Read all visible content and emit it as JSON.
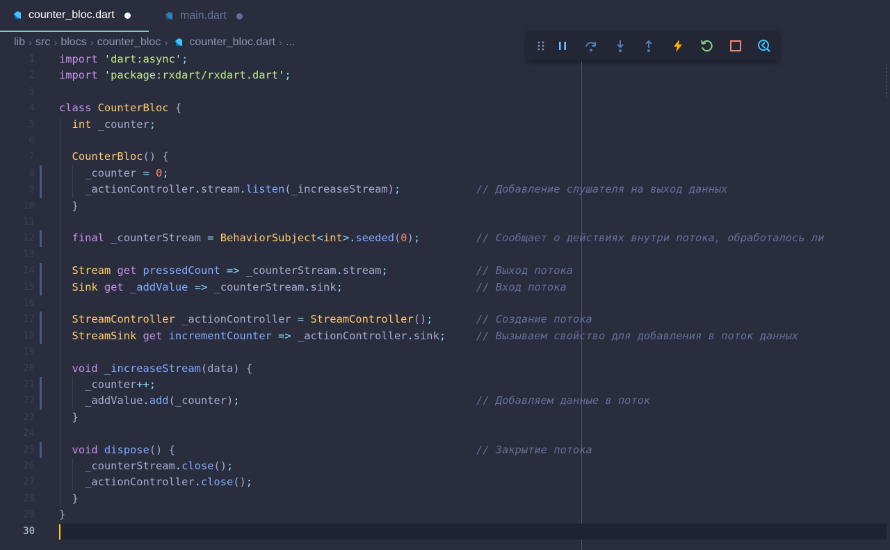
{
  "tabs": [
    {
      "label": "counter_bloc.dart",
      "active": true,
      "dirty": true
    },
    {
      "label": "main.dart",
      "active": false,
      "dirty": true
    }
  ],
  "breadcrumb": [
    "lib",
    "src",
    "blocs",
    "counter_bloc",
    "counter_bloc.dart",
    "..."
  ],
  "debug_toolbar": [
    "grip-icon",
    "pause-icon",
    "step-over-icon",
    "step-into-icon",
    "step-out-icon",
    "hot-reload-icon",
    "hot-restart-icon",
    "stop-icon",
    "devtools-icon"
  ],
  "colors": {
    "background": "#292d3e",
    "keyword": "#c792ea",
    "string": "#c3e88d",
    "class": "#ffcb6b",
    "function": "#82aaff",
    "number": "#f78c6c",
    "operator": "#89ddff",
    "comment": "#676e95",
    "cursor": "#ffcc00"
  },
  "current_line": 30,
  "lines": [
    {
      "n": "1",
      "tokens": [
        [
          "import ",
          "k"
        ],
        [
          "'dart:async'",
          "s"
        ],
        [
          ";",
          "o"
        ]
      ],
      "comment": ""
    },
    {
      "n": "2",
      "tokens": [
        [
          "import ",
          "k"
        ],
        [
          "'package:rxdart/rxdart.dart'",
          "s"
        ],
        [
          ";",
          "o"
        ]
      ],
      "comment": ""
    },
    {
      "n": "3",
      "tokens": [],
      "comment": ""
    },
    {
      "n": "4",
      "tokens": [
        [
          "class ",
          "k"
        ],
        [
          "CounterBloc",
          "c"
        ],
        [
          " {",
          "p"
        ]
      ],
      "comment": ""
    },
    {
      "n": "5",
      "tokens": [
        [
          "  ",
          "p"
        ],
        [
          "int",
          "c"
        ],
        [
          " _counter",
          "p"
        ],
        [
          ";",
          "o"
        ]
      ],
      "comment": ""
    },
    {
      "n": "6",
      "tokens": [],
      "comment": ""
    },
    {
      "n": "7",
      "tokens": [
        [
          "  ",
          "p"
        ],
        [
          "CounterBloc",
          "c"
        ],
        [
          "() {",
          "p"
        ]
      ],
      "comment": ""
    },
    {
      "n": "8",
      "tokens": [
        [
          "    _counter ",
          "p"
        ],
        [
          "=",
          "o"
        ],
        [
          " ",
          "p"
        ],
        [
          "0",
          "n"
        ],
        [
          ";",
          "o"
        ]
      ],
      "comment": ""
    },
    {
      "n": "9",
      "tokens": [
        [
          "    _actionController",
          "p"
        ],
        [
          ".",
          "o"
        ],
        [
          "stream",
          "p"
        ],
        [
          ".",
          "o"
        ],
        [
          "listen",
          "f"
        ],
        [
          "(_increaseStream)",
          "p"
        ],
        [
          ";",
          "o"
        ]
      ],
      "comment": "// Добавление слушателя на выход данных"
    },
    {
      "n": "10",
      "tokens": [
        [
          "  }",
          "p"
        ]
      ],
      "comment": ""
    },
    {
      "n": "11",
      "tokens": [],
      "comment": ""
    },
    {
      "n": "12",
      "tokens": [
        [
          "  ",
          "p"
        ],
        [
          "final",
          "k"
        ],
        [
          " _counterStream ",
          "p"
        ],
        [
          "=",
          "o"
        ],
        [
          " ",
          "p"
        ],
        [
          "BehaviorSubject",
          "c"
        ],
        [
          "<",
          "o"
        ],
        [
          "int",
          "c"
        ],
        [
          ">",
          "o"
        ],
        [
          ".",
          "o"
        ],
        [
          "seeded",
          "f"
        ],
        [
          "(",
          "p"
        ],
        [
          "0",
          "n"
        ],
        [
          ")",
          "p"
        ],
        [
          ";",
          "o"
        ]
      ],
      "comment": "// Сообщает о действиях внутри потока, обработалось ли"
    },
    {
      "n": "13",
      "tokens": [],
      "comment": ""
    },
    {
      "n": "14",
      "tokens": [
        [
          "  ",
          "p"
        ],
        [
          "Stream",
          "c"
        ],
        [
          " ",
          "p"
        ],
        [
          "get",
          "k"
        ],
        [
          " ",
          "p"
        ],
        [
          "pressedCount",
          "f"
        ],
        [
          " ",
          "p"
        ],
        [
          "=>",
          "o"
        ],
        [
          " _counterStream",
          "p"
        ],
        [
          ".",
          "o"
        ],
        [
          "stream",
          "p"
        ],
        [
          ";",
          "o"
        ]
      ],
      "comment": "// Выход потока"
    },
    {
      "n": "15",
      "tokens": [
        [
          "  ",
          "p"
        ],
        [
          "Sink",
          "c"
        ],
        [
          " ",
          "p"
        ],
        [
          "get",
          "k"
        ],
        [
          " ",
          "p"
        ],
        [
          "_addValue",
          "f"
        ],
        [
          " ",
          "p"
        ],
        [
          "=>",
          "o"
        ],
        [
          " _counterStream",
          "p"
        ],
        [
          ".",
          "o"
        ],
        [
          "sink",
          "p"
        ],
        [
          ";",
          "o"
        ]
      ],
      "comment": "// Вход потока"
    },
    {
      "n": "16",
      "tokens": [],
      "comment": ""
    },
    {
      "n": "17",
      "tokens": [
        [
          "  ",
          "p"
        ],
        [
          "StreamController",
          "c"
        ],
        [
          " _actionController ",
          "p"
        ],
        [
          "=",
          "o"
        ],
        [
          " ",
          "p"
        ],
        [
          "StreamController",
          "c"
        ],
        [
          "()",
          "p"
        ],
        [
          ";",
          "o"
        ]
      ],
      "comment": "// Создание потока"
    },
    {
      "n": "18",
      "tokens": [
        [
          "  ",
          "p"
        ],
        [
          "StreamSink",
          "c"
        ],
        [
          " ",
          "p"
        ],
        [
          "get",
          "k"
        ],
        [
          " ",
          "p"
        ],
        [
          "incrementCounter",
          "f"
        ],
        [
          " ",
          "p"
        ],
        [
          "=>",
          "o"
        ],
        [
          " _actionController",
          "p"
        ],
        [
          ".",
          "o"
        ],
        [
          "sink",
          "p"
        ],
        [
          ";",
          "o"
        ]
      ],
      "comment": "// Вызываем свойство для добавления в поток данных"
    },
    {
      "n": "19",
      "tokens": [],
      "comment": ""
    },
    {
      "n": "20",
      "tokens": [
        [
          "  ",
          "p"
        ],
        [
          "void",
          "k"
        ],
        [
          " ",
          "p"
        ],
        [
          "_increaseStream",
          "f"
        ],
        [
          "(data) {",
          "p"
        ]
      ],
      "comment": ""
    },
    {
      "n": "21",
      "tokens": [
        [
          "    _counter",
          "p"
        ],
        [
          "++",
          "o"
        ],
        [
          ";",
          "o"
        ]
      ],
      "comment": ""
    },
    {
      "n": "22",
      "tokens": [
        [
          "    _addValue",
          "p"
        ],
        [
          ".",
          "o"
        ],
        [
          "add",
          "f"
        ],
        [
          "(_counter)",
          "p"
        ],
        [
          ";",
          "o"
        ]
      ],
      "comment": "// Добавляем данные в поток"
    },
    {
      "n": "23",
      "tokens": [
        [
          "  }",
          "p"
        ]
      ],
      "comment": ""
    },
    {
      "n": "24",
      "tokens": [],
      "comment": ""
    },
    {
      "n": "25",
      "tokens": [
        [
          "  ",
          "p"
        ],
        [
          "void",
          "k"
        ],
        [
          " ",
          "p"
        ],
        [
          "dispose",
          "f"
        ],
        [
          "() {",
          "p"
        ]
      ],
      "comment": "// Закрытие потока"
    },
    {
      "n": "26",
      "tokens": [
        [
          "    _counterStream",
          "p"
        ],
        [
          ".",
          "o"
        ],
        [
          "close",
          "f"
        ],
        [
          "()",
          "p"
        ],
        [
          ";",
          "o"
        ]
      ],
      "comment": ""
    },
    {
      "n": "27",
      "tokens": [
        [
          "    _actionController",
          "p"
        ],
        [
          ".",
          "o"
        ],
        [
          "close",
          "f"
        ],
        [
          "()",
          "p"
        ],
        [
          ";",
          "o"
        ]
      ],
      "comment": ""
    },
    {
      "n": "28",
      "tokens": [
        [
          "  }",
          "p"
        ]
      ],
      "comment": ""
    },
    {
      "n": "29",
      "tokens": [
        [
          "}",
          "p"
        ]
      ],
      "comment": ""
    },
    {
      "n": "30",
      "tokens": [],
      "comment": ""
    }
  ]
}
